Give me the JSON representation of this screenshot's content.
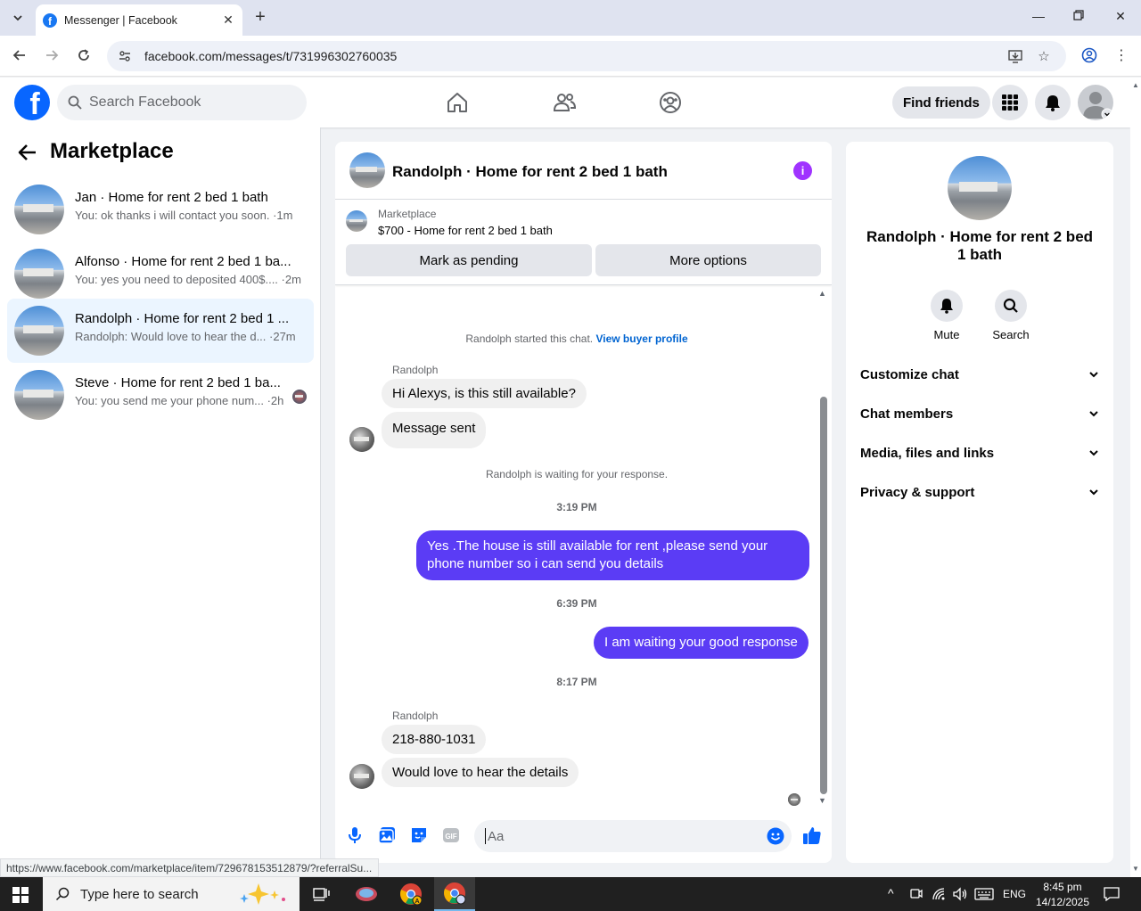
{
  "browser": {
    "tab_title": "Messenger | Facebook",
    "url": "facebook.com/messages/t/731996302760035",
    "status_url": "https://www.facebook.com/marketplace/item/729678153512879/?referralSu..."
  },
  "fb_header": {
    "search_placeholder": "Search Facebook",
    "find_friends": "Find friends"
  },
  "left_panel": {
    "title": "Marketplace",
    "conversations": [
      {
        "name": "Jan · Home for rent 2 bed 1 bath",
        "snippet": "You: ok thanks i will contact you soon. ·1m"
      },
      {
        "name": "Alfonso · Home for rent 2 bed 1 ba...",
        "snippet": "You: yes you need to deposited 400$.... ·2m"
      },
      {
        "name": "Randolph · Home for rent 2 bed 1 ...",
        "snippet": "Randolph: Would love to hear the d... ·27m"
      },
      {
        "name": "Steve · Home for rent 2 bed 1 ba...",
        "snippet": "You: you send me your phone num... ·2h"
      }
    ]
  },
  "chat": {
    "title": "Randolph · Home for rent 2 bed 1 bath",
    "listing_label": "Marketplace",
    "listing_desc": "$700 - Home for rent 2 bed 1 bath",
    "mark_pending": "Mark as pending",
    "more_options": "More options",
    "started_text": "Randolph started this chat.",
    "view_profile": "View buyer profile",
    "sender_name": "Randolph",
    "msg1": "Hi Alexys, is this still available?",
    "msg2": "Message sent",
    "waiting": "Randolph is waiting for your response.",
    "time1": "3:19 PM",
    "out1": "Yes .The house is still available for rent ,please send your phone number so i can send you details",
    "time2": "6:39 PM",
    "out2": "I am waiting your good response",
    "time3": "8:17 PM",
    "sender_name2": "Randolph",
    "msg3": "218-880-1031",
    "msg4": "Would love to hear the details",
    "composer_placeholder": "Aa"
  },
  "right_panel": {
    "title": "Randolph · Home for rent 2 bed 1 bath",
    "mute": "Mute",
    "search": "Search",
    "sections": [
      "Customize chat",
      "Chat members",
      "Media, files and links",
      "Privacy & support"
    ]
  },
  "taskbar": {
    "search_text": "Type here to search",
    "lang": "ENG",
    "time": "8:45 pm",
    "date": "14/12/2025"
  },
  "colors": {
    "fb_blue": "#0866ff",
    "outgoing_bubble": "#5b3cf5",
    "info_purple": "#a033ff",
    "active_conv": "#ebf5ff"
  }
}
